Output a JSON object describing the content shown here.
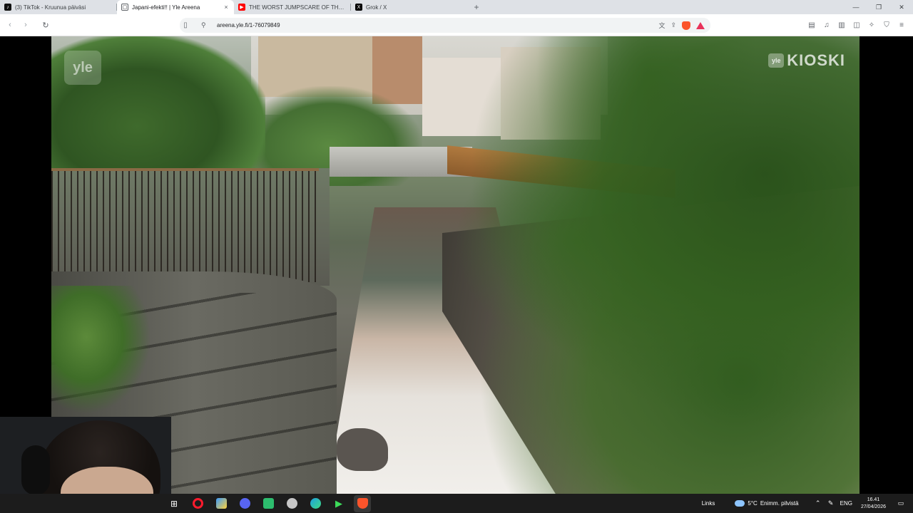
{
  "browser": {
    "tabs": [
      {
        "title": "(3) TikTok - Kruunua päiväsi",
        "favicon": "tiktok-icon",
        "favicon_color": "#111111",
        "active": false
      },
      {
        "title": "Japani-efekti!! | Yle Areena",
        "favicon": "yle-icon",
        "favicon_color": "#202124",
        "active": true
      },
      {
        "title": "THE WORST JUMPSCARE OF THE YEAR",
        "favicon": "youtube-icon",
        "favicon_color": "#ff0000",
        "active": false
      },
      {
        "title": "Grok / X",
        "favicon": "x-icon",
        "favicon_color": "#000000",
        "active": false
      }
    ],
    "new_tab_glyph": "+",
    "close_glyph": "×",
    "url": "areena.yle.fi/1-76079849"
  },
  "video": {
    "watermark_left": "yle",
    "watermark_right_small": "yle",
    "watermark_right": "KIOSKI"
  },
  "taskbar": {
    "links_label": "Links",
    "temperature": "5°C",
    "weather_text": "Enimm. pilvistä",
    "language": "ENG",
    "time": "16.41",
    "date": "27/04/2026",
    "apps": [
      {
        "name": "windows-icon",
        "color": "#ffffff"
      },
      {
        "name": "opera-icon",
        "color": "#ff1b2d"
      },
      {
        "name": "files-app-icon",
        "color": "#3b9cff"
      },
      {
        "name": "discord-icon",
        "color": "#5865f2"
      },
      {
        "name": "messaging-app-icon",
        "color": "#2dbd6e"
      },
      {
        "name": "shield-app-icon",
        "color": "#c7c7c7"
      },
      {
        "name": "edge-icon",
        "color": "#1ea0e0"
      },
      {
        "name": "play-app-icon",
        "color": "#3ddc5a"
      },
      {
        "name": "brave-icon",
        "color": "#fb542b"
      }
    ]
  }
}
